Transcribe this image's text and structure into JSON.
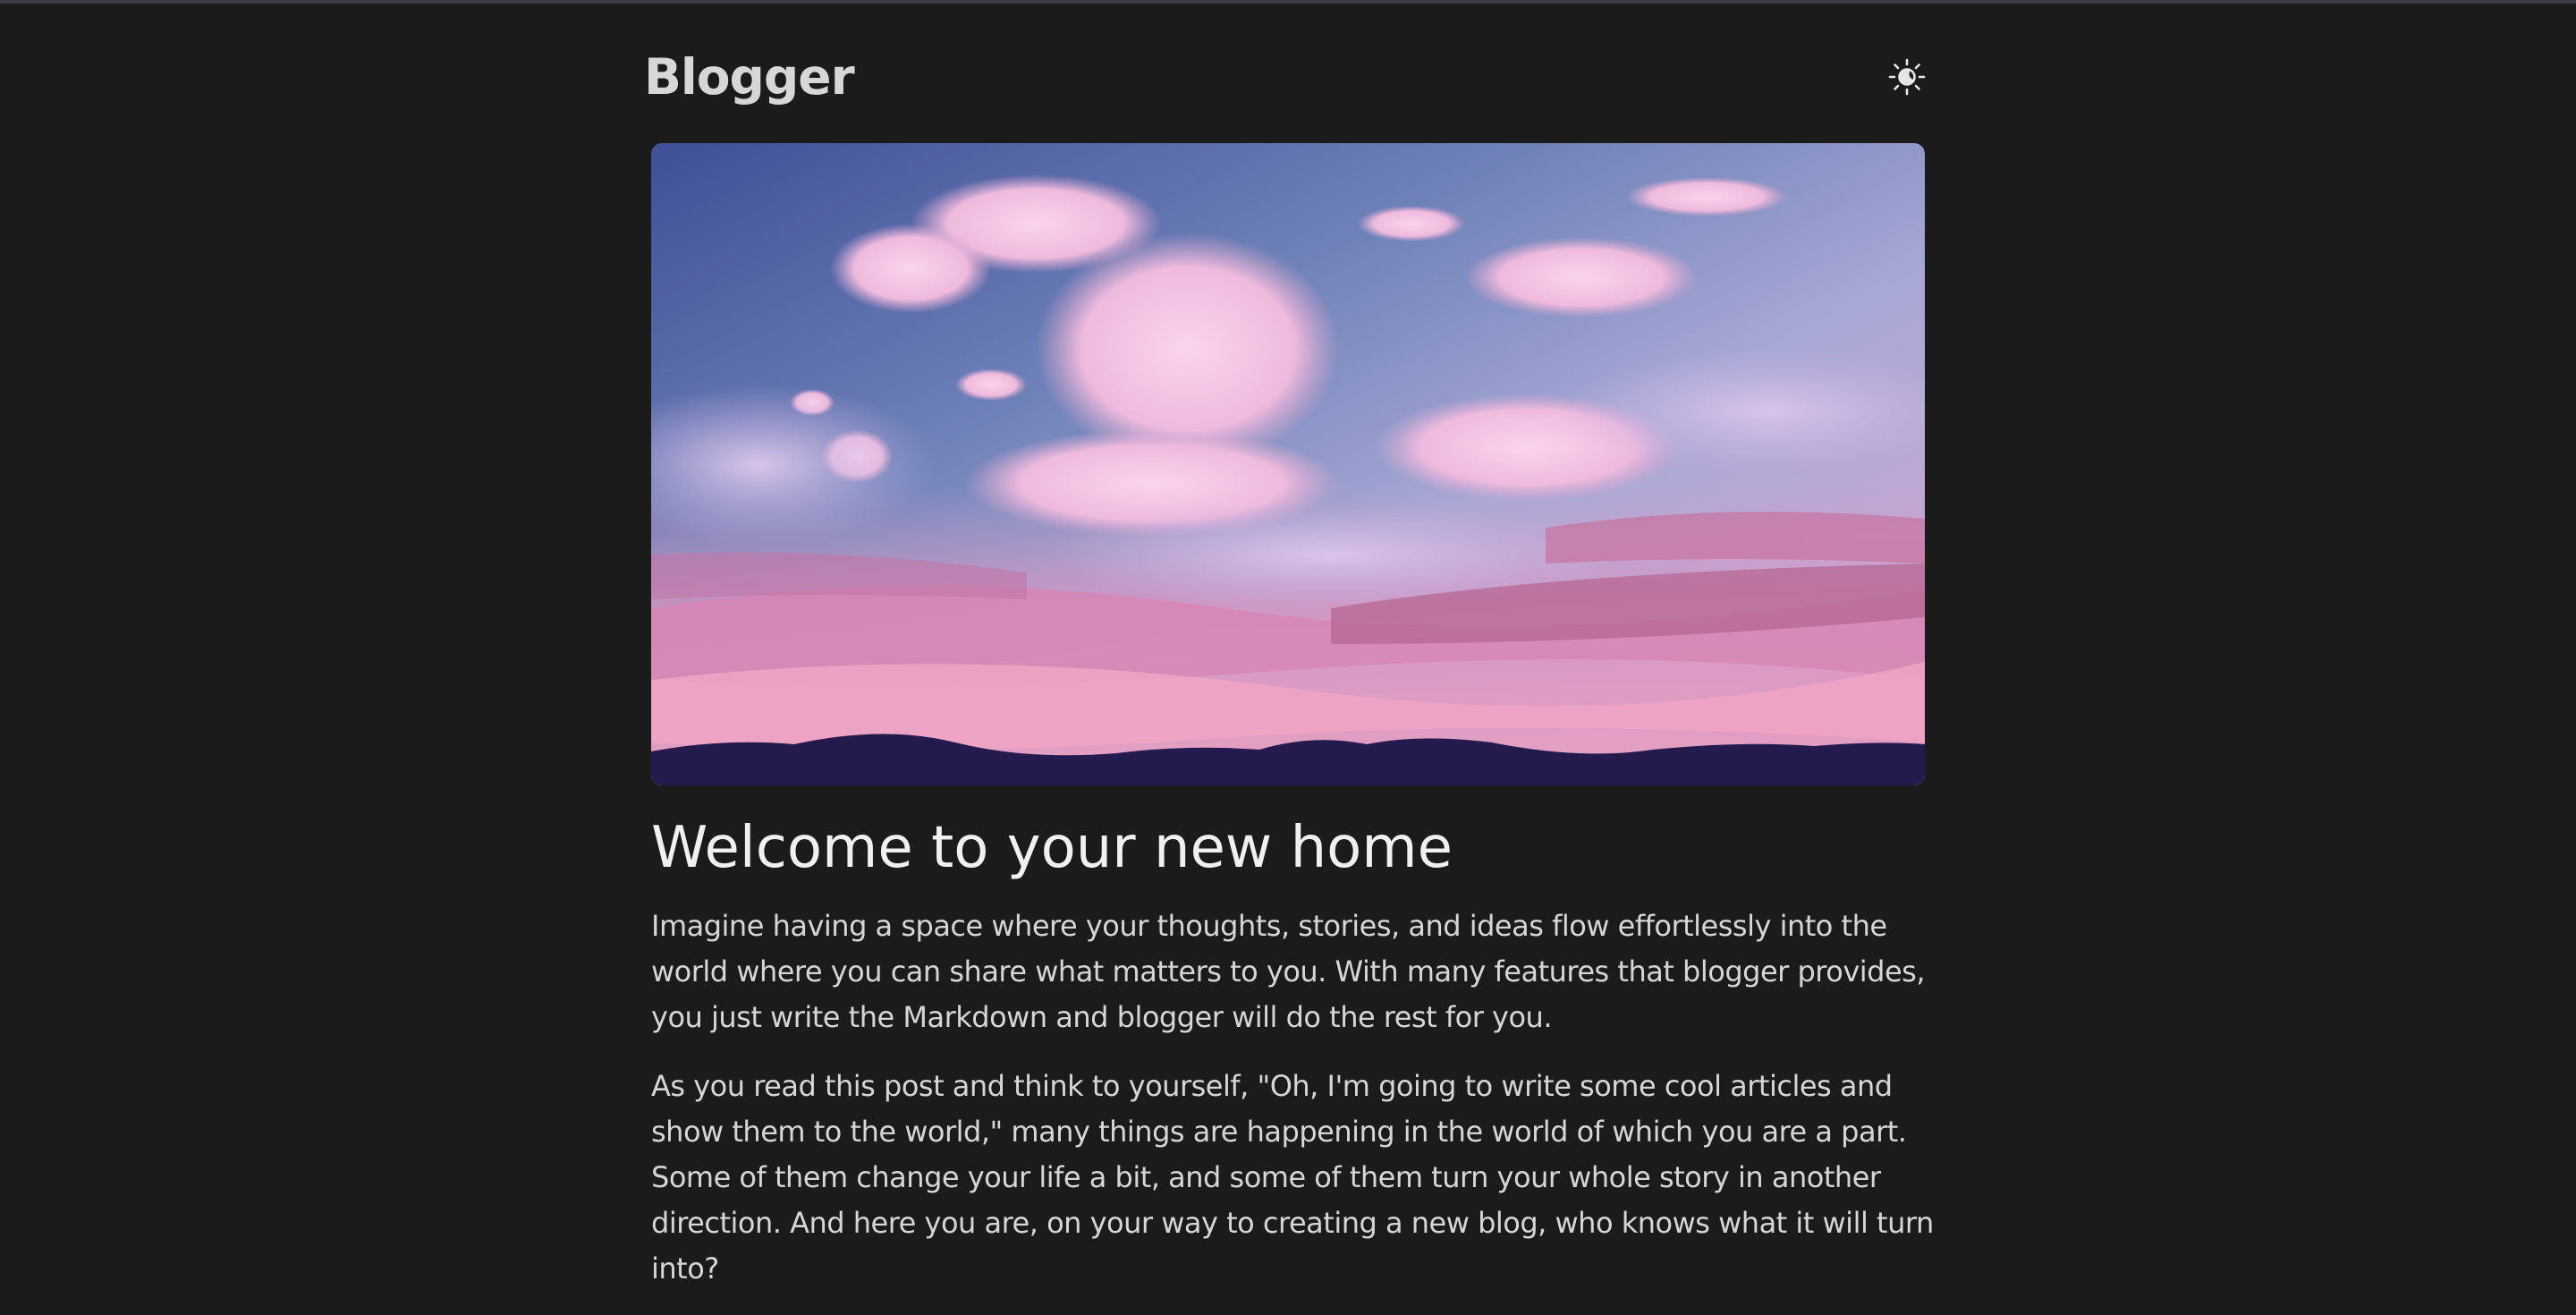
{
  "header": {
    "brand": "Blogger",
    "theme_toggle_icon": "sun-moon-icon"
  },
  "hero": {
    "image": "sky-clouds-illustration"
  },
  "post": {
    "title": "Welcome to your new home",
    "paragraphs": [
      "Imagine having a space where your thoughts, stories, and ideas flow effortlessly into the world where you can share what matters to you. With many features that blogger provides, you just write the Markdown and blogger will do the rest for you.",
      "As you read this post and think to yourself, \"Oh, I'm going to write some cool articles and show them to the world,\" many things are happening in the world of which you are a part. Some of them change your life a bit, and some of them turn your whole story in another direction. And here you are, on your way to creating a new blog, who knows what it will turn into?"
    ]
  },
  "colors": {
    "background": "#1c1b1c",
    "text": "#d6d6d6",
    "title": "#f0f0f0"
  }
}
